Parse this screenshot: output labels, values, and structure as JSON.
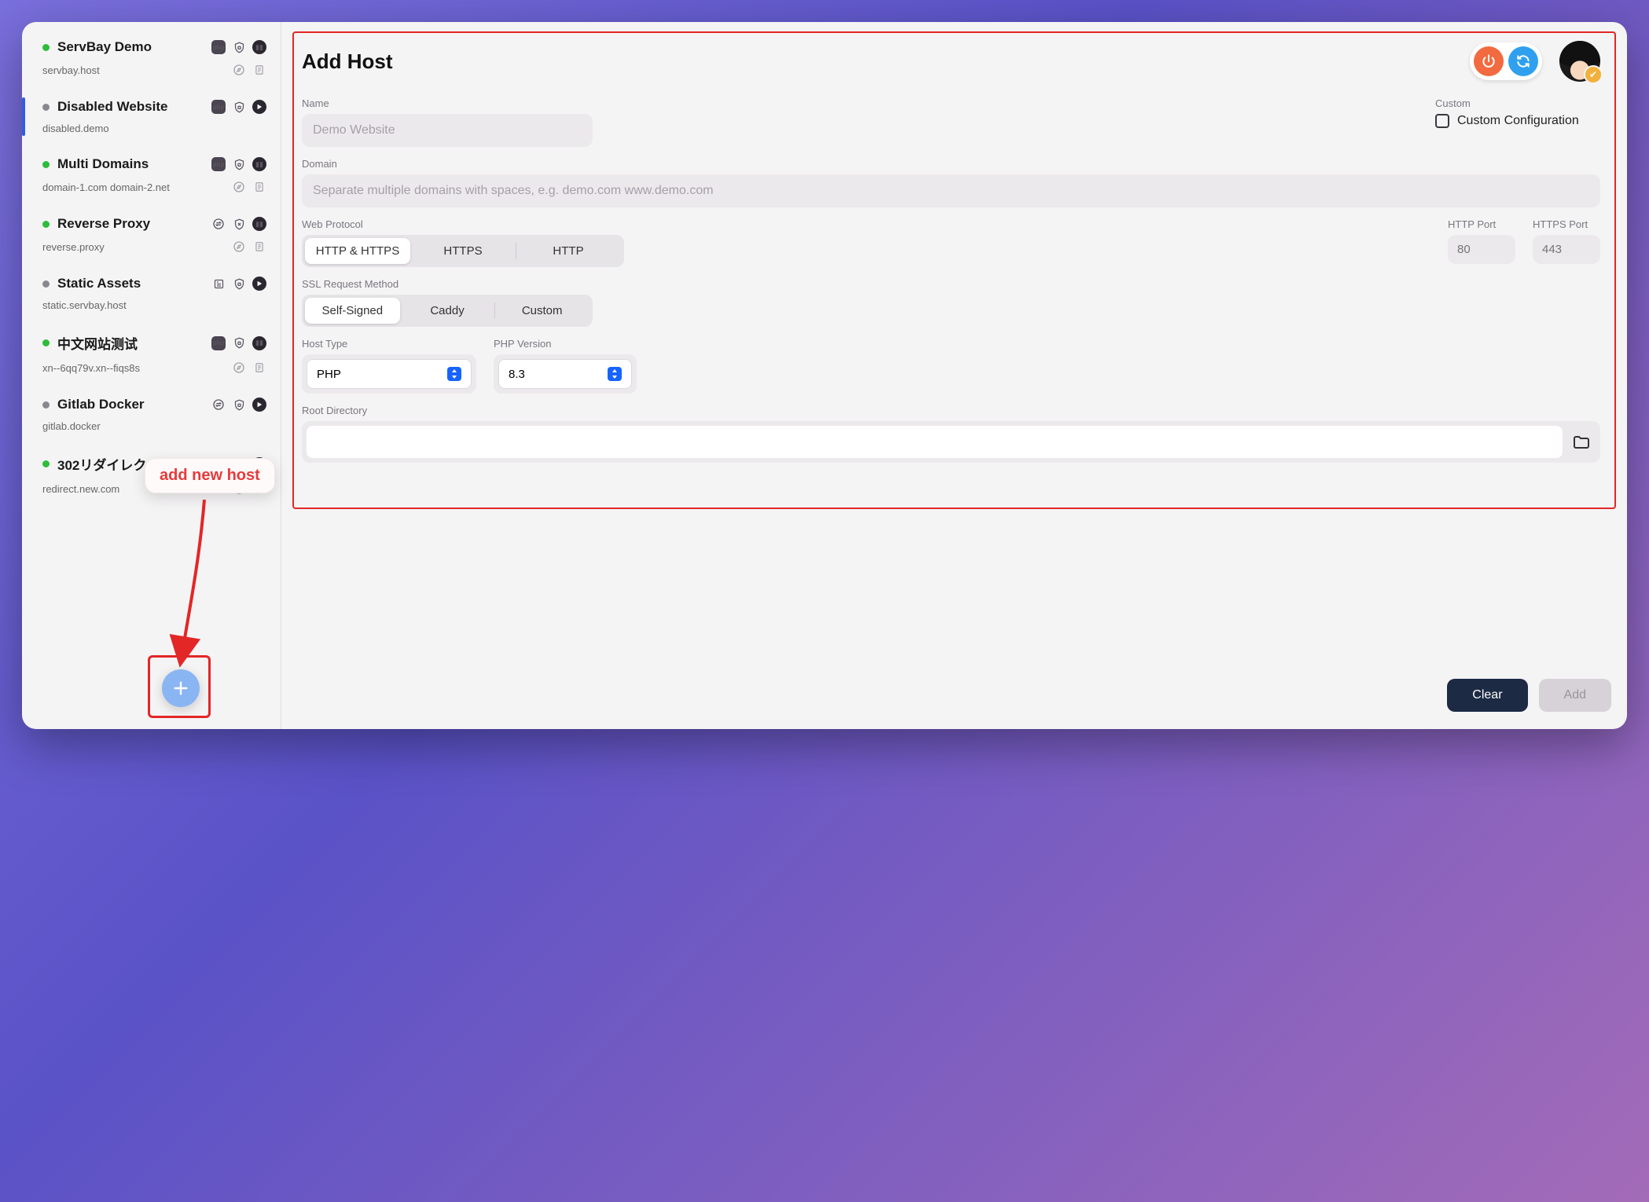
{
  "sidebar": {
    "items": [
      {
        "status": "green",
        "name": "ServBay Demo",
        "domain": "servbay.host",
        "badge": "php",
        "secure": true,
        "action": "pause"
      },
      {
        "status": "grey",
        "name": "Disabled Website",
        "domain": "disabled.demo",
        "badge": "php",
        "secure": true,
        "action": "play",
        "selected": true
      },
      {
        "status": "green",
        "name": "Multi Domains",
        "domain": "domain-1.com domain-2.net",
        "badge": "php",
        "secure": true,
        "action": "pause"
      },
      {
        "status": "green",
        "name": "Reverse Proxy",
        "domain": "reverse.proxy",
        "badge": "swap",
        "secure": "x",
        "action": "pause"
      },
      {
        "status": "grey",
        "name": "Static Assets",
        "domain": "static.servbay.host",
        "badge": "static",
        "secure": true,
        "action": "play"
      },
      {
        "status": "green",
        "name": "中文网站测试",
        "domain": "xn--6qq79v.xn--fiqs8s",
        "badge": "php",
        "secure": true,
        "action": "pause"
      },
      {
        "status": "grey",
        "name": "Gitlab Docker",
        "domain": "gitlab.docker",
        "badge": "swap",
        "secure": true,
        "action": "play"
      },
      {
        "status": "green",
        "name": "302リダイレクト",
        "domain": "redirect.new.com",
        "badge": "redirect",
        "secure": true,
        "action": "pause"
      }
    ]
  },
  "annotation": {
    "callout": "add new host"
  },
  "header": {
    "title": "Add Host"
  },
  "form": {
    "name_label": "Name",
    "name_placeholder": "Demo Website",
    "custom_label": "Custom",
    "custom_checkbox": "Custom Configuration",
    "domain_label": "Domain",
    "domain_placeholder": "Separate multiple domains with spaces, e.g. demo.com www.demo.com",
    "protocol_label": "Web Protocol",
    "protocol_options": [
      "HTTP & HTTPS",
      "HTTPS",
      "HTTP"
    ],
    "protocol_selected": 0,
    "http_port_label": "HTTP Port",
    "http_port_placeholder": "80",
    "https_port_label": "HTTPS Port",
    "https_port_placeholder": "443",
    "ssl_label": "SSL Request Method",
    "ssl_options": [
      "Self-Signed",
      "Caddy",
      "Custom"
    ],
    "ssl_selected": 0,
    "host_type_label": "Host Type",
    "host_type_value": "PHP",
    "php_version_label": "PHP Version",
    "php_version_value": "8.3",
    "root_label": "Root Directory"
  },
  "footer": {
    "clear": "Clear",
    "add": "Add"
  }
}
